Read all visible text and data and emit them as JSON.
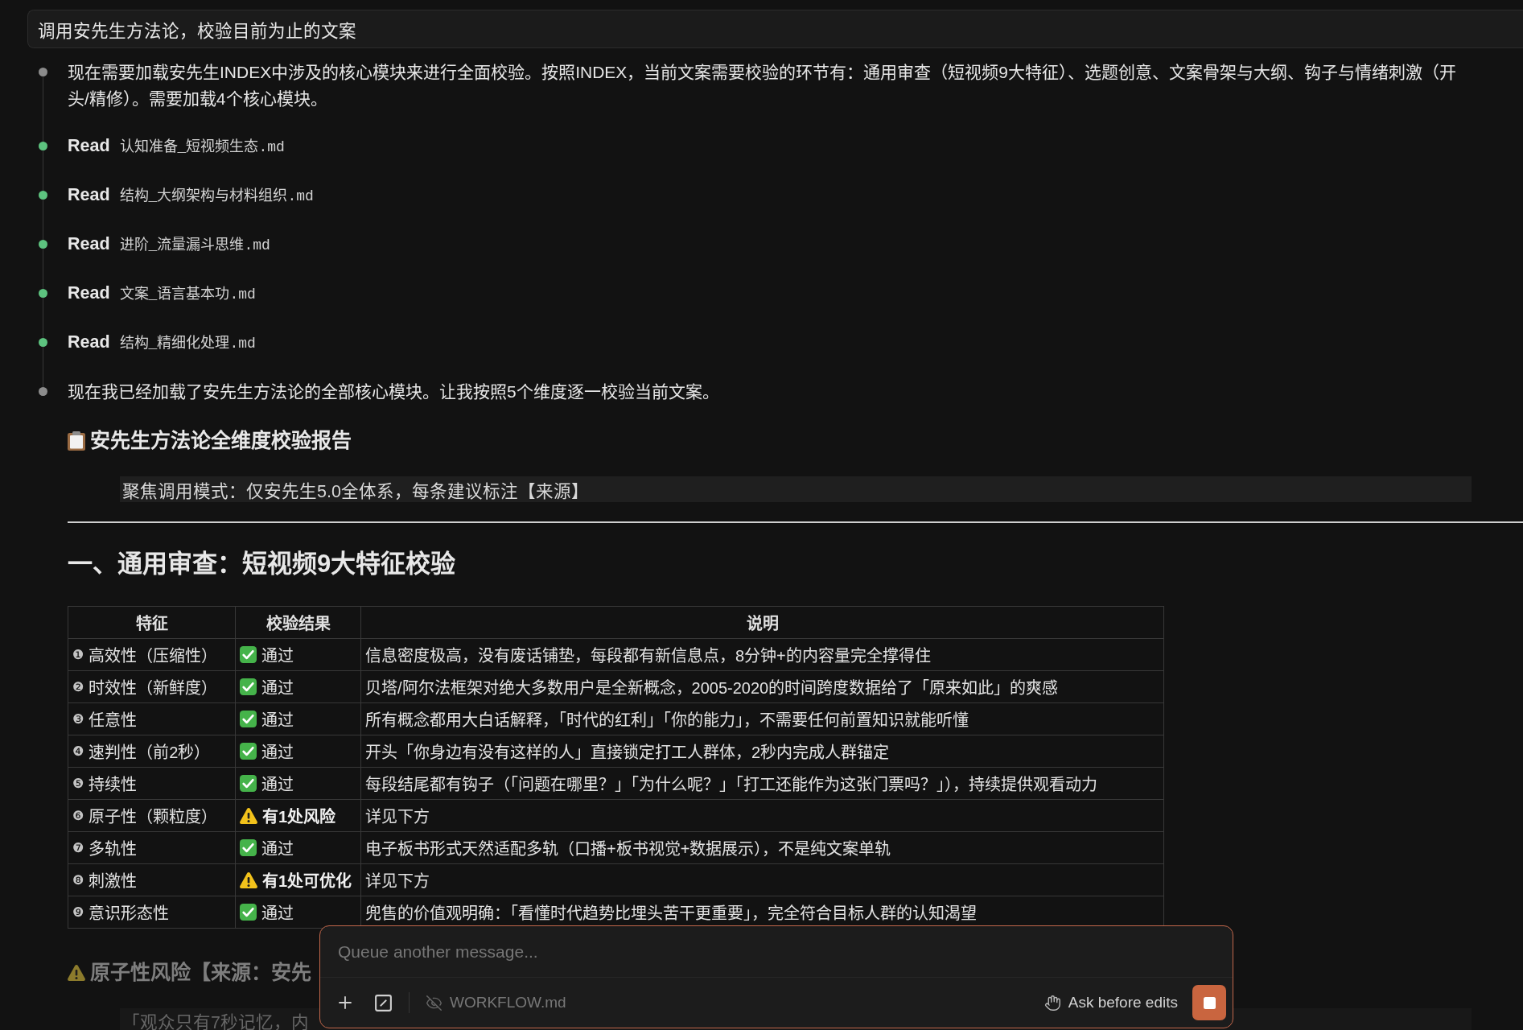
{
  "user_message": {
    "text": "调用安先生方法论，校验目前为止的文案"
  },
  "timeline": [
    {
      "kind": "text",
      "color": "#8c8c8c",
      "text": "现在需要加载安先生INDEX中涉及的核心模块来进行全面校验。按照INDEX，当前文案需要校验的环节有：通用审查（短视频9大特征）、选题创意、文案骨架与大纲、钩子与情绪刺激（开头/精修）。需要加载4个核心模块。"
    },
    {
      "kind": "read",
      "color": "#5dc37f",
      "label": "Read",
      "file": "认知准备_短视频生态.md"
    },
    {
      "kind": "read",
      "color": "#5dc37f",
      "label": "Read",
      "file": "结构_大纲架构与材料组织.md"
    },
    {
      "kind": "read",
      "color": "#5dc37f",
      "label": "Read",
      "file": "进阶_流量漏斗思维.md"
    },
    {
      "kind": "read",
      "color": "#5dc37f",
      "label": "Read",
      "file": "文案_语言基本功.md"
    },
    {
      "kind": "read",
      "color": "#5dc37f",
      "label": "Read",
      "file": "结构_精细化处理.md"
    },
    {
      "kind": "text",
      "color": "#8c8c8c",
      "text": "现在我已经加载了安先生方法论的全部核心模块。让我按照5个维度逐一校验当前文案。"
    }
  ],
  "report": {
    "title": "安先生方法论全维度校验报告",
    "note": "聚焦调用模式：仅安先生5.0全体系，每条建议标注【来源】",
    "section_title": "一、通用审查：短视频9大特征校验",
    "table": {
      "columns": [
        "特征",
        "校验结果",
        "说明"
      ],
      "rows": [
        {
          "num": "❶",
          "feature": "高效性（压缩性）",
          "result": {
            "kind": "pass",
            "text": "通过"
          },
          "note": "信息密度极高，没有废话铺垫，每段都有新信息点，8分钟+的内容量完全撑得住"
        },
        {
          "num": "❷",
          "feature": "时效性（新鲜度）",
          "result": {
            "kind": "pass",
            "text": "通过"
          },
          "note": "贝塔/阿尔法框架对绝大多数用户是全新概念，2005-2020的时间跨度数据给了「原来如此」的爽感"
        },
        {
          "num": "❸",
          "feature": "任意性",
          "result": {
            "kind": "pass",
            "text": "通过"
          },
          "note": "所有概念都用大白话解释，「时代的红利」「你的能力」，不需要任何前置知识就能听懂"
        },
        {
          "num": "❹",
          "feature": "速判性（前2秒）",
          "result": {
            "kind": "pass",
            "text": "通过"
          },
          "note": "开头「你身边有没有这样的人」直接锁定打工人群体，2秒内完成人群锚定"
        },
        {
          "num": "❺",
          "feature": "持续性",
          "result": {
            "kind": "pass",
            "text": "通过"
          },
          "note": "每段结尾都有钩子（「问题在哪里？」「为什么呢？」「打工还能作为这张门票吗？」），持续提供观看动力"
        },
        {
          "num": "❻",
          "feature": "原子性（颗粒度）",
          "result": {
            "kind": "warn",
            "text": "有1处风险"
          },
          "note": "详见下方"
        },
        {
          "num": "❼",
          "feature": "多轨性",
          "result": {
            "kind": "pass",
            "text": "通过"
          },
          "note": "电子板书形式天然适配多轨（口播+板书视觉+数据展示），不是纯文案单轨"
        },
        {
          "num": "❽",
          "feature": "刺激性",
          "result": {
            "kind": "warn",
            "text": "有1处可优化"
          },
          "note": "详见下方"
        },
        {
          "num": "❾",
          "feature": "意识形态性",
          "result": {
            "kind": "pass",
            "text": "通过"
          },
          "note": "兜售的价值观明确：「看懂时代趋势比埋头苦干更重要」，完全符合目标人群的认知渴望"
        }
      ]
    },
    "subsection": {
      "title": "原子性风险【来源：安先",
      "quote": "「观众只有7秒记忆，内"
    }
  },
  "composer": {
    "placeholder": "Queue another message...",
    "file": "WORKFLOW.md",
    "mode": "Ask before edits"
  }
}
